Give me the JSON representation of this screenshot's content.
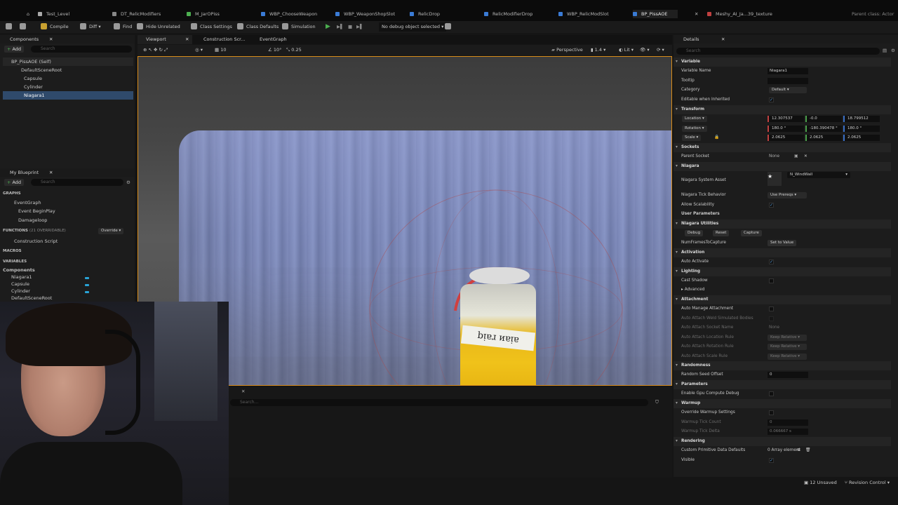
{
  "title_tabs": [
    "Test_Level",
    "DT_RelicModifiers",
    "M_JarOPiss",
    "WBP_ChooseWeapon",
    "WBP_WeaponShopSlot",
    "RelicDrop",
    "RelicModifierDrop",
    "WBP_RelicModSlot",
    "BP_PissAOE",
    "Meshy_AI_Ja...39_texture"
  ],
  "parent_class": "Parent class: Actor",
  "toolbar": {
    "compile": "Compile",
    "diff": "Diff",
    "find": "Find",
    "hide_unrelated": "Hide Unrelated",
    "class_settings": "Class Settings",
    "class_defaults": "Class Defaults",
    "simulation": "Simulation",
    "debug_select": "No debug object selected"
  },
  "components_panel": {
    "title": "Components",
    "add": "Add",
    "search_placeholder": "Search",
    "items": [
      "BP_PissAOE (Self)",
      "DefaultSceneRoot",
      "Capsule",
      "Cylinder",
      "Niagara1"
    ]
  },
  "my_blueprint": {
    "title": "My Blueprint",
    "add": "Add",
    "search_placeholder": "Search",
    "graphs_label": "GRAPHS",
    "graphs": [
      "EventGraph",
      "Event BeginPlay",
      "Damageloop"
    ],
    "functions_label": "FUNCTIONS",
    "functions_count": "(21 OVERRIDABLE)",
    "override": "Override",
    "functions": [
      "Construction Script"
    ],
    "macros_label": "MACROS",
    "variables_label": "VARIABLES",
    "components_label": "Components",
    "variables": [
      "Niagara1",
      "Capsule",
      "Cylinder",
      "DefaultSceneRoot"
    ]
  },
  "viewport_tabs": [
    "Viewport",
    "Construction Scr...",
    "EventGraph"
  ],
  "viewport_tools": {
    "perspective": "Perspective",
    "lit": "Lit",
    "fov": "1.4",
    "snap_grid": "10",
    "snap_angle": "10°",
    "snap_scale": "0.25"
  },
  "jar_label": "bᴉɐɹ ᴎɐᴉɐ",
  "details": {
    "title": "Details",
    "search_placeholder": "Search",
    "variable_section": "Variable",
    "variable_name_label": "Variable Name",
    "variable_name": "Niagara1",
    "tooltip_label": "Tooltip",
    "category_label": "Category",
    "category": "Default",
    "editable_label": "Editable when Inherited",
    "transform_section": "Transform",
    "location_label": "Location",
    "location": [
      "12.307537",
      "-0.0",
      "18.799512"
    ],
    "rotation_label": "Rotation",
    "rotation": [
      "180.0 °",
      "-180.390478 °",
      "180.0 °"
    ],
    "scale_label": "Scale",
    "scale": [
      "2.0625",
      "2.0625",
      "2.0625"
    ],
    "sockets_section": "Sockets",
    "parent_socket_label": "Parent Socket",
    "parent_socket": "None",
    "niagara_section": "Niagara",
    "system_asset_label": "Niagara System Asset",
    "system_asset": "N_WindWall",
    "tick_label": "Niagara Tick Behavior",
    "tick": "Use Prereqs",
    "scalability_label": "Allow Scalability",
    "user_params": "User Parameters",
    "utilities_section": "Niagara Utilities",
    "debug": "Debug",
    "reset": "Reset",
    "capture": "Capture",
    "frames_label": "NumFramesToCapture",
    "set_to_value": "Set to Value",
    "activation_section": "Activation",
    "auto_activate": "Auto Activate",
    "lighting_section": "Lighting",
    "cast_shadow": "Cast Shadow",
    "advanced": "Advanced",
    "attachment_section": "Attachment",
    "auto_manage": "Auto Manage Attachment",
    "auto_attach_sim": "Auto Attach Weld Simulated Bodies",
    "auto_attach_socket": "Auto Attach Socket Name",
    "socket_none": "None",
    "auto_attach_loc": "Auto Attach Location Rule",
    "auto_attach_rot": "Auto Attach Rotation Rule",
    "auto_attach_scale": "Auto Attach Scale Rule",
    "keep_relative": "Keep Relative",
    "randomness_section": "Randomness",
    "random_seed_label": "Random Seed Offset",
    "random_seed": "0",
    "parameters_section": "Parameters",
    "gpu_debug": "Enable Gpu Compute Debug",
    "warmup_section": "Warmup",
    "override_warmup": "Override Warmup Settings",
    "warmup_tick_count_label": "Warmup Tick Count",
    "warmup_tick_count": "0",
    "warmup_tick_delta_label": "Warmup Tick Delta",
    "warmup_tick_delta": "0.066667 s",
    "rendering_section": "Rendering",
    "custom_primitive": "Custom Primitive Data Defaults",
    "array_elements": "0 Array element",
    "visible": "Visible"
  },
  "output": {
    "search_placeholder": "Search..."
  },
  "status": {
    "unsaved": "12 Unsaved",
    "revision": "Revision Control"
  }
}
